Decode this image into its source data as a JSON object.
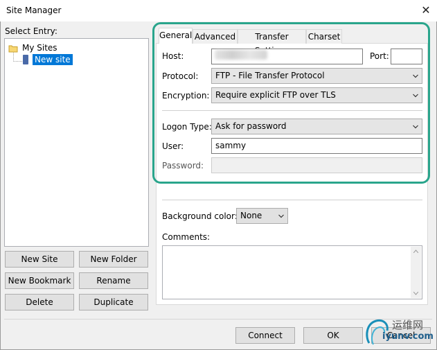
{
  "window": {
    "title": "Site Manager"
  },
  "left": {
    "select_entry_label": "Select Entry:",
    "tree": {
      "root": "My Sites",
      "item": "New site"
    },
    "buttons": {
      "new_site": "New Site",
      "new_folder": "New Folder",
      "new_bookmark": "New Bookmark",
      "rename": "Rename",
      "delete": "Delete",
      "duplicate": "Duplicate"
    }
  },
  "tabs": [
    "General",
    "Advanced",
    "Transfer Settings",
    "Charset"
  ],
  "general": {
    "host_label": "Host:",
    "port_label": "Port:",
    "protocol_label": "Protocol:",
    "protocol_value": "FTP - File Transfer Protocol",
    "encryption_label": "Encryption:",
    "encryption_value": "Require explicit FTP over TLS",
    "logon_type_label": "Logon Type:",
    "logon_type_value": "Ask for password",
    "user_label": "User:",
    "user_value": "sammy",
    "password_label": "Password:",
    "background_color_label": "Background color:",
    "background_color_value": "None",
    "comments_label": "Comments:"
  },
  "footer": {
    "connect": "Connect",
    "ok": "OK",
    "cancel": "Cancel"
  },
  "watermark": {
    "line1": "运维网",
    "line2": "iyunv.com"
  },
  "colors": {
    "highlight": "#2aa58c",
    "selection": "#0078d7"
  }
}
